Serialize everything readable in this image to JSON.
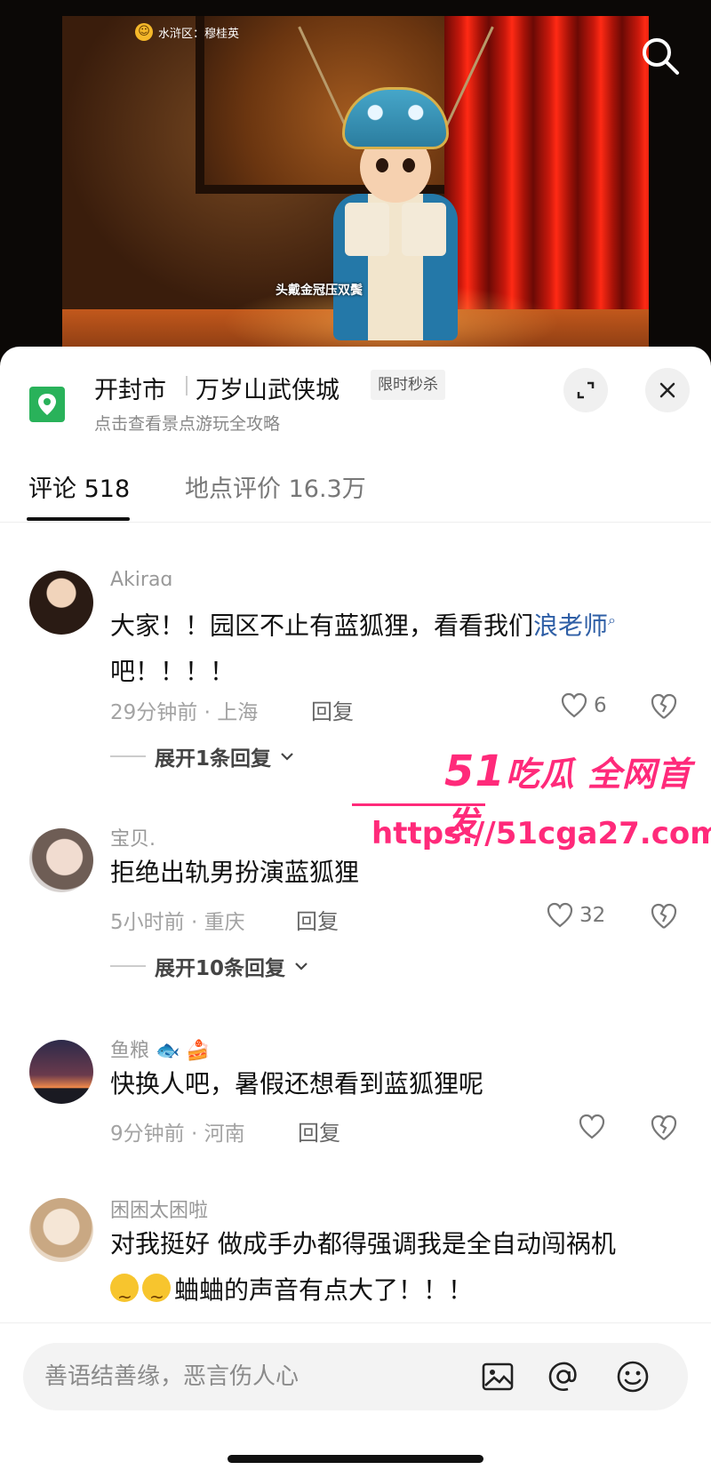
{
  "video": {
    "badge_text": "水浒区：穆桂英",
    "subtitle": "头戴金冠压双鬓"
  },
  "location": {
    "city": "开封市",
    "place": "万岁山武侠城",
    "badge": "限时秒杀",
    "subtitle": "点击查看景点游玩全攻略"
  },
  "tabs": {
    "comments": "评论 518",
    "ratings": "地点评价 16.3万"
  },
  "comments": [
    {
      "user": "Akiraɑ",
      "text_before": "大家！！园区不止有蓝狐狸，看看我们",
      "mention": "浪老师",
      "text_after": "吧！！！！",
      "meta": "29分钟前 · 上海",
      "reply": "回复",
      "likes": "6",
      "expand": "展开1条回复"
    },
    {
      "user": "宝贝.",
      "text": "拒绝出轨男扮演蓝狐狸",
      "meta": "5小时前 · 重庆",
      "reply": "回复",
      "likes": "32",
      "expand": "展开10条回复"
    },
    {
      "user": "鱼粮",
      "text": "快换人吧，暑假还想看到蓝狐狸呢",
      "meta": "9分钟前 · 河南",
      "reply": "回复",
      "likes": ""
    },
    {
      "user": "困困太困啦",
      "text_line1": "对我挺好 做成手办都得强调我是全自动闯祸机",
      "text_line2": "蛐蛐的声音有点大了！！！"
    }
  ],
  "watermark": {
    "line1_num": "51",
    "line1_text": "吃瓜 全网首发",
    "line2": "https://51cga27.com"
  },
  "input": {
    "placeholder": "善语结善缘，恶言伤人心"
  },
  "colors": {
    "mention": "#2f5fa6",
    "watermark": "#ff2a7a",
    "location_icon": "#29b25a"
  }
}
